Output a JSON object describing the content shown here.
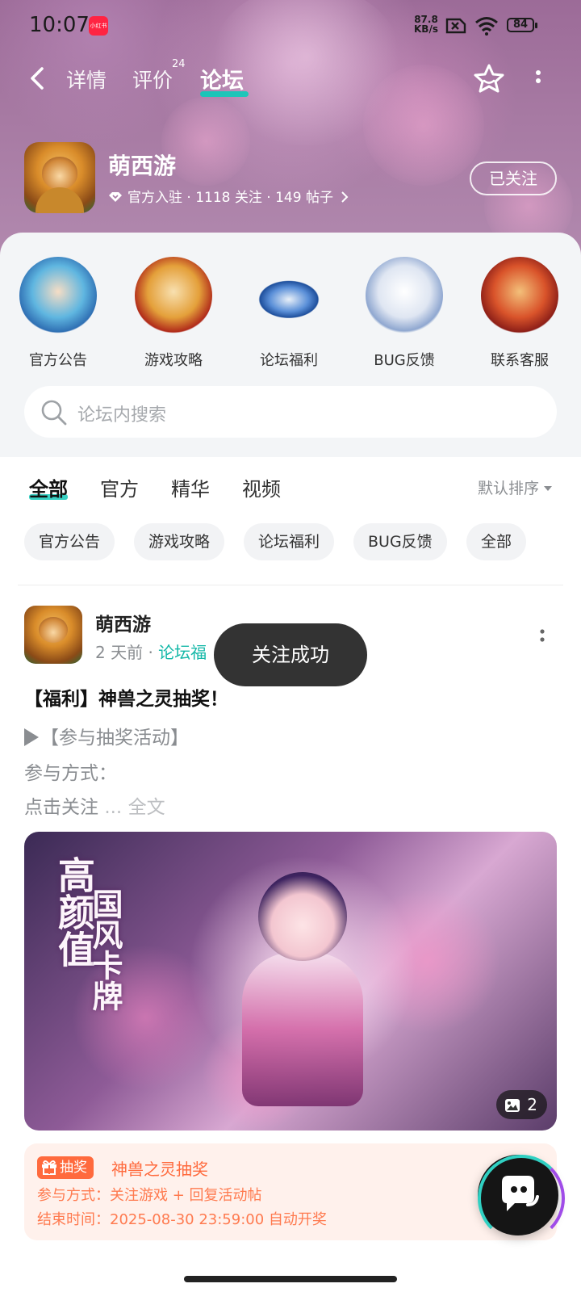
{
  "status_bar": {
    "time": "10:07",
    "app_badge": "小红书",
    "net_speed_value": "87.8",
    "net_speed_unit": "KB/s",
    "battery": "84"
  },
  "nav": {
    "tabs": [
      {
        "label": "详情",
        "active": false
      },
      {
        "label": "评价",
        "badge": "24",
        "active": false
      },
      {
        "label": "论坛",
        "active": true
      }
    ]
  },
  "game": {
    "name": "萌西游",
    "meta_official": "官方入驻",
    "meta_followers": "1118 关注",
    "meta_posts": "149 帖子",
    "follow_button": "已关注"
  },
  "categories": [
    {
      "label": "官方公告"
    },
    {
      "label": "游戏攻略"
    },
    {
      "label": "论坛福利"
    },
    {
      "label": "BUG反馈"
    },
    {
      "label": "联系客服"
    }
  ],
  "search": {
    "placeholder": "论坛内搜索"
  },
  "filter_tabs": [
    {
      "label": "全部",
      "active": true
    },
    {
      "label": "官方",
      "active": false
    },
    {
      "label": "精华",
      "active": false
    },
    {
      "label": "视频",
      "active": false
    }
  ],
  "sort_label": "默认排序",
  "chips": [
    "官方公告",
    "游戏攻略",
    "论坛福利",
    "BUG反馈",
    "全部"
  ],
  "post": {
    "author": "萌西游",
    "time": "2 天前",
    "tag": "论坛福",
    "title": "【福利】神兽之灵抽奖！",
    "line1": "【参与抽奖活动】",
    "line2": "参与方式：",
    "line3": "点击关注",
    "ellipsis": "...",
    "full_text": "全文",
    "image_calligraphy_1": "高颜值",
    "image_calligraphy_2": "国风卡牌",
    "image_count": "2",
    "lottery": {
      "badge": "抽奖",
      "title": "神兽之灵抽奖",
      "method": "参与方式：关注游戏 + 回复活动帖",
      "end": "结束时间：2025-08-30 23:59:00 自动开奖"
    }
  },
  "toast": "关注成功",
  "colors": {
    "accent": "#14c8b8",
    "lottery": "#ff6a3d",
    "header": "#a77aa3"
  }
}
